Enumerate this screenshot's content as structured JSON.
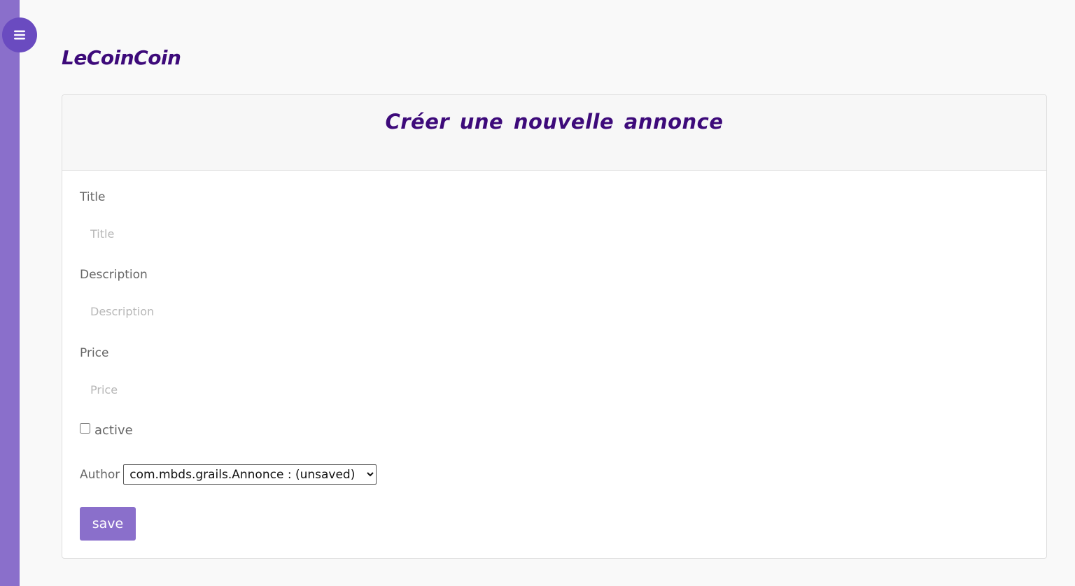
{
  "sidebar": {
    "menu_icon": "hamburger-menu-icon"
  },
  "brand": {
    "name": "LeCoinCoin"
  },
  "card": {
    "title": "Créer une nouvelle annonce"
  },
  "form": {
    "title": {
      "label": "Title",
      "placeholder": "Title",
      "value": ""
    },
    "description": {
      "label": "Description",
      "placeholder": "Description",
      "value": ""
    },
    "price": {
      "label": "Price",
      "placeholder": "Price",
      "value": ""
    },
    "active": {
      "label": "active",
      "checked": false
    },
    "author": {
      "label": "Author",
      "selected": "com.mbds.grails.Annonce : (unsaved)"
    },
    "save_label": "save"
  },
  "colors": {
    "accent": "#8a6fcb",
    "accent_dark": "#6a4bc0",
    "title_purple": "#3d0a7a"
  }
}
